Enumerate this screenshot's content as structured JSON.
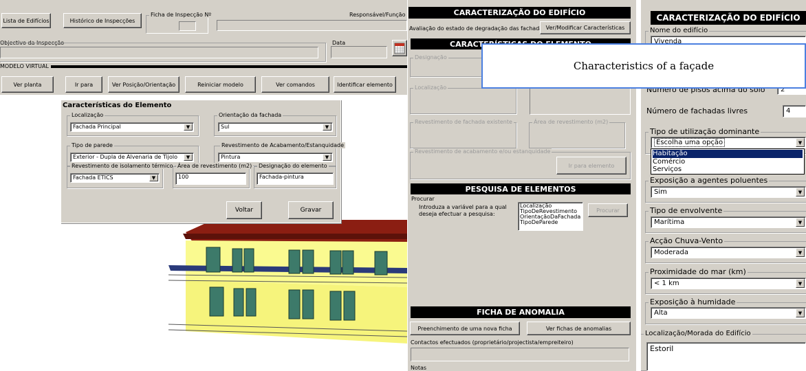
{
  "left": {
    "buttons": [
      "Lista de Edifícios",
      "Histórico de Inspecções",
      "Ver planta",
      "Ir para",
      "Ver Posição/Orientação",
      "Reiniciar modelo",
      "Ver comandos",
      "Identificar elemento",
      "Voltar",
      "Gravar"
    ],
    "ficha_label": "Ficha de Inspecção Nº",
    "responsavel_label": "Responsável/Função",
    "objectivo_label": "Objectivo da Inspecção",
    "data_label": "Data",
    "modelo_label": "MODELO VIRTUAL",
    "dialog": {
      "title": "Características do Elemento",
      "localizacao_label": "Localização",
      "localizacao_value": "Fachada Principal",
      "orientacao_label": "Orientação da fachada",
      "orientacao_value": "Sul",
      "tipo_parede_label": "Tipo de parede",
      "tipo_parede_value": "Exterior - Dupla de Alvenaria de Tijolo",
      "revestimento_label": "Revestimento de Acabamento/Estanquidade",
      "revestimento_value": "Pintura",
      "isolamento_label": "Revestimento de isolamento térmico",
      "isolamento_value": "Fachada ETICS",
      "area_label": "Área de revestimento (m2)",
      "area_value": "100",
      "designacao_label": "Designação do elemento",
      "designacao_value": "Fachada-pintura"
    }
  },
  "middle": {
    "header1": "CARACTERIZAÇÃO DO EDIFÍCIO",
    "avaliacao_label": "Avaliação do estado de degradação das fachadas:",
    "ver_button": "Ver/Modificar Características",
    "header2": "CARACTERÍSTICAS DO ELEMENTO",
    "designacao": "Designação",
    "localizacao": "Localização",
    "revest_fachada": "Revestimento de fachada existente",
    "area_rev": "Área de revestimento (m2)",
    "revest_acab": "Revestimento de acabamento e/ou estanquidade",
    "ir_para_elemento": "Ir para elemento",
    "header3": "PESQUISA DE ELEMENTOS",
    "procurar_label": "Procurar",
    "pesquisa_text": "Introduza a variável para a qual deseja efectuar a pesquisa:",
    "pesquisa_options": [
      "Localização",
      "TipoDeRevestimento",
      "OrientaçãoDaFachada",
      "TipoDeParede"
    ],
    "procurar_button": "Procurar",
    "header4": "FICHA DE ANOMALIA",
    "preench_button": "Preenchimento de uma nova ficha",
    "ver_fichas_button": "Ver fichas de anomalias",
    "contactos_label": "Contactos efectuados (proprietário/projectista/empreiteiro)",
    "notas_label": "Notas"
  },
  "callout": "Characteristics of a façade",
  "right": {
    "header": "CARACTERIZAÇÃO DO EDIFÍCIO",
    "nome_label": "Nome do edifício",
    "nome_value": "Vivenda",
    "pisos_label": "Número de pisos acima do solo",
    "pisos_value": "2",
    "fachadas_label": "Número de fachadas livres",
    "fachadas_value": "4",
    "utilizacao_label": "Tipo de utilização dominante",
    "utilizacao_value": "Escolha uma opção",
    "utilizacao_options": [
      "Habitação",
      "Comércio",
      "Serviços"
    ],
    "poluentes_label": "Exposição a agentes poluentes",
    "poluentes_value": "Sim",
    "envolvente_label": "Tipo de envolvente",
    "envolvente_value": "Marítima",
    "chuva_label": "Acção Chuva-Vento",
    "chuva_value": "Moderada",
    "mar_label": "Proximidade do mar (km)",
    "mar_value": "< 1 km",
    "humidade_label": "Exposição à humidade",
    "humidade_value": "Alta",
    "morada_label": "Localização/Morada do Edifício",
    "morada_value": "Estoril"
  }
}
